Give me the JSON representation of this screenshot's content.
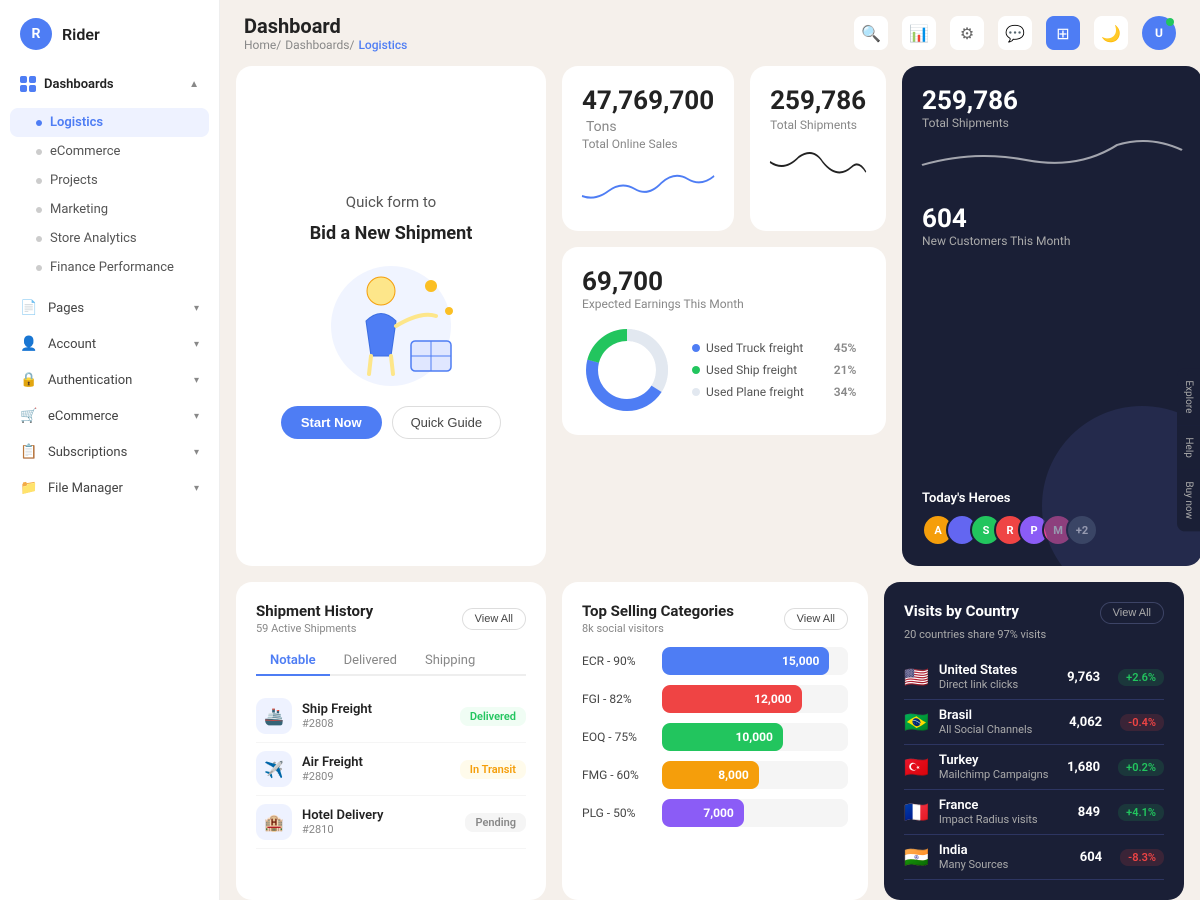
{
  "app": {
    "logo_letter": "R",
    "logo_name": "Rider"
  },
  "sidebar": {
    "dashboards_label": "Dashboards",
    "items": [
      {
        "label": "Logistics",
        "active": true
      },
      {
        "label": "eCommerce",
        "active": false
      },
      {
        "label": "Projects",
        "active": false
      },
      {
        "label": "Marketing",
        "active": false
      },
      {
        "label": "Store Analytics",
        "active": false
      },
      {
        "label": "Finance Performance",
        "active": false
      }
    ],
    "nav_items": [
      {
        "label": "Pages",
        "icon": "📄"
      },
      {
        "label": "Account",
        "icon": "👤"
      },
      {
        "label": "Authentication",
        "icon": "🔒"
      },
      {
        "label": "eCommerce",
        "icon": "🛒"
      },
      {
        "label": "Subscriptions",
        "icon": "📋"
      },
      {
        "label": "File Manager",
        "icon": "📁"
      }
    ]
  },
  "topbar": {
    "title": "Dashboard",
    "breadcrumb": [
      "Home/",
      "Dashboards/",
      "Logistics"
    ]
  },
  "hero": {
    "title": "Quick form to",
    "subtitle": "Bid a New Shipment",
    "btn_primary": "Start Now",
    "btn_secondary": "Quick Guide"
  },
  "stats": {
    "total_sales_value": "47,769,700",
    "total_sales_unit": "Tons",
    "total_sales_label": "Total Online Sales",
    "total_shipments_value": "259,786",
    "total_shipments_label": "Total Shipments",
    "earnings_value": "69,700",
    "earnings_label": "Expected Earnings This Month",
    "new_customers_value": "604",
    "new_customers_label": "New Customers This Month",
    "freight": [
      {
        "label": "Used Truck freight",
        "pct": "45%",
        "color": "#4e7df4"
      },
      {
        "label": "Used Ship freight",
        "pct": "21%",
        "color": "#22c55e"
      },
      {
        "label": "Used Plane freight",
        "pct": "34%",
        "color": "#e2e8f0"
      }
    ],
    "heroes_label": "Today's Heroes",
    "avatars": [
      {
        "initial": "A",
        "color": "#f59e0b"
      },
      {
        "initial": "S",
        "color": "#22c55e"
      },
      {
        "initial": "R",
        "color": "#ef4444"
      },
      {
        "initial": "P",
        "color": "#8b5cf6"
      },
      {
        "initial": "M",
        "color": "#ec4899"
      },
      {
        "initial": "+2",
        "color": "#64748b"
      }
    ]
  },
  "shipment_history": {
    "title": "Shipment History",
    "sub": "59 Active Shipments",
    "view_all": "View All",
    "tabs": [
      "Notable",
      "Delivered",
      "Shipping"
    ],
    "active_tab": "Notable",
    "items": [
      {
        "name": "Ship Freight",
        "id": "#2808",
        "status": "Delivered"
      },
      {
        "name": "Air Freight",
        "id": "#2809",
        "status": "In Transit"
      },
      {
        "name": "Hotel Delivery",
        "id": "#2810",
        "status": "Pending"
      }
    ]
  },
  "top_selling": {
    "title": "Top Selling Categories",
    "sub": "8k social visitors",
    "view_all": "View All",
    "bars": [
      {
        "label": "ECR - 90%",
        "value": 15000,
        "display": "15,000",
        "color": "#4e7df4",
        "width": "90%"
      },
      {
        "label": "FGI - 82%",
        "value": 12000,
        "display": "12,000",
        "color": "#ef4444",
        "width": "75%"
      },
      {
        "label": "EOQ - 75%",
        "value": 10000,
        "display": "10,000",
        "color": "#22c55e",
        "width": "65%"
      },
      {
        "label": "FMG - 60%",
        "value": 8000,
        "display": "8,000",
        "color": "#f59e0b",
        "width": "52%"
      },
      {
        "label": "PLG - 50%",
        "value": 7000,
        "display": "7,000",
        "color": "#8b5cf6",
        "width": "44%"
      }
    ]
  },
  "visits": {
    "title": "Visits by Country",
    "sub": "20 countries share 97% visits",
    "view_all": "View All",
    "countries": [
      {
        "flag": "🇺🇸",
        "name": "United States",
        "source": "Direct link clicks",
        "visits": "9,763",
        "change": "+2.6%",
        "up": true
      },
      {
        "flag": "🇧🇷",
        "name": "Brasil",
        "source": "All Social Channels",
        "visits": "4,062",
        "change": "-0.4%",
        "up": false
      },
      {
        "flag": "🇹🇷",
        "name": "Turkey",
        "source": "Mailchimp Campaigns",
        "visits": "1,680",
        "change": "+0.2%",
        "up": true
      },
      {
        "flag": "🇫🇷",
        "name": "France",
        "source": "Impact Radius visits",
        "visits": "849",
        "change": "+4.1%",
        "up": true
      },
      {
        "flag": "🇮🇳",
        "name": "India",
        "source": "Many Sources",
        "visits": "604",
        "change": "-8.3%",
        "up": false
      }
    ]
  },
  "side_tabs": [
    "Explore",
    "Help",
    "Buy now"
  ]
}
